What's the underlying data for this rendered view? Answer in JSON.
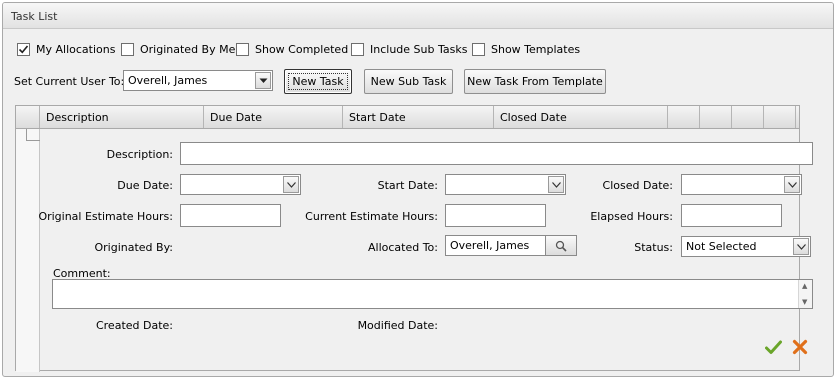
{
  "panel": {
    "title": "Task List"
  },
  "filters": [
    {
      "label": "My Allocations",
      "checked": true
    },
    {
      "label": "Originated By Me",
      "checked": false
    },
    {
      "label": "Show Completed",
      "checked": false
    },
    {
      "label": "Include Sub Tasks",
      "checked": false
    },
    {
      "label": "Show Templates",
      "checked": false
    }
  ],
  "current_user": {
    "label": "Set Current User To:",
    "value": "Overell, James"
  },
  "toolbar": {
    "new_task": "New Task",
    "new_sub_task": "New Sub Task",
    "new_task_from_template": "New Task From Template"
  },
  "grid": {
    "columns": [
      "Description",
      "Due Date",
      "Start Date",
      "Closed Date",
      "",
      "",
      "",
      "",
      ""
    ]
  },
  "form": {
    "description_label": "Description:",
    "description_value": "",
    "due_date_label": "Due Date:",
    "due_date_value": "",
    "start_date_label": "Start Date:",
    "start_date_value": "",
    "closed_date_label": "Closed Date:",
    "closed_date_value": "",
    "original_estimate_label": "Original Estimate Hours:",
    "original_estimate_value": "",
    "current_estimate_label": "Current Estimate Hours:",
    "current_estimate_value": "",
    "elapsed_hours_label": "Elapsed Hours:",
    "elapsed_hours_value": "",
    "originated_by_label": "Originated By:",
    "originated_by_value": "",
    "allocated_to_label": "Allocated To:",
    "allocated_to_value": "Overell, James",
    "status_label": "Status:",
    "status_value": "Not Selected",
    "comment_label": "Comment:",
    "comment_value": "",
    "created_date_label": "Created Date:",
    "created_date_value": "",
    "modified_date_label": "Modified Date:",
    "modified_date_value": ""
  },
  "icons": {
    "accept": "checkmark-icon",
    "cancel": "x-icon",
    "accept_color": "#6aa52a",
    "cancel_color": "#e0701b"
  }
}
